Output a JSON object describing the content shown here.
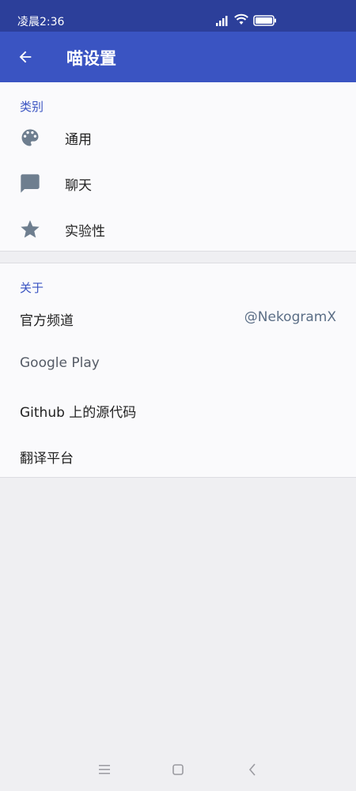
{
  "status_bar": {
    "time": "凌晨2:36"
  },
  "app_bar": {
    "title": "喵设置",
    "back_icon": "arrow-left-icon"
  },
  "categories": {
    "header": "类别",
    "items": [
      {
        "label": "通用",
        "icon": "palette-icon"
      },
      {
        "label": "聊天",
        "icon": "chat-bubble-icon"
      },
      {
        "label": "实验性",
        "icon": "star-icon"
      }
    ]
  },
  "about": {
    "header": "关于",
    "items": [
      {
        "label": "官方频道",
        "value": "@NekogramX"
      },
      {
        "label": "Google Play"
      },
      {
        "label": "Github 上的源代码"
      },
      {
        "label": "翻译平台"
      }
    ]
  },
  "colors": {
    "status_bar": "#2c3f9a",
    "app_bar": "#3a54c2",
    "accent": "#3a54c2",
    "icon": "#6e7e8f",
    "background": "#efeff2"
  }
}
